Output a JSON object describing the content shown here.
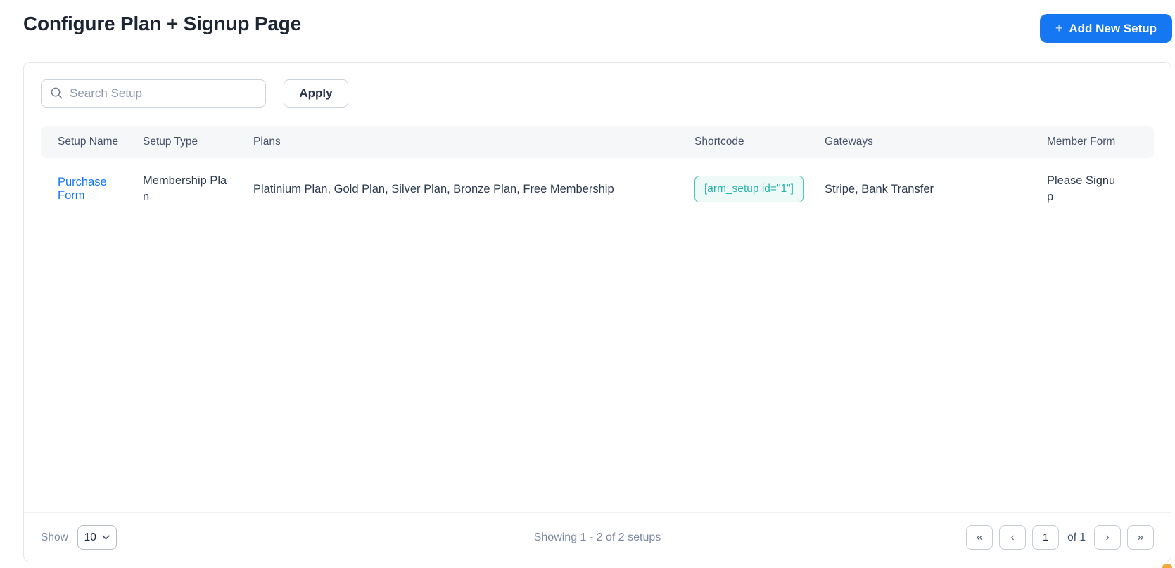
{
  "page": {
    "title": "Configure Plan + Signup Page"
  },
  "header": {
    "add_button_plus": "+",
    "add_button_label": "Add New Setup"
  },
  "toolbar": {
    "search_placeholder": "Search Setup",
    "apply_label": "Apply"
  },
  "table": {
    "columns": [
      "Setup Name",
      "Setup Type",
      "Plans",
      "Shortcode",
      "Gateways",
      "Member Form"
    ],
    "rows": [
      {
        "setup_name": "Purchase Form",
        "setup_type": "Membership Plan",
        "plans": "Platinium Plan, Gold Plan, Silver Plan, Bronze Plan, Free Membership",
        "shortcode": "[arm_setup id=\"1\"]",
        "gateways": "Stripe, Bank Transfer",
        "member_form": "Please Signup"
      }
    ]
  },
  "footer": {
    "show_label": "Show",
    "per_page": "10",
    "summary": "Showing 1 - 2 of 2 setups",
    "pagination": {
      "first": "«",
      "prev": "‹",
      "page": "1",
      "of_label": "of 1",
      "next": "›",
      "last": "»"
    }
  },
  "colors": {
    "accent_blue": "#1677f2",
    "link_blue": "#1677f2",
    "shortcode_teal": "#27b2a8",
    "shortcode_bg": "#eefaf8",
    "header_bg": "#f6f7f9"
  }
}
